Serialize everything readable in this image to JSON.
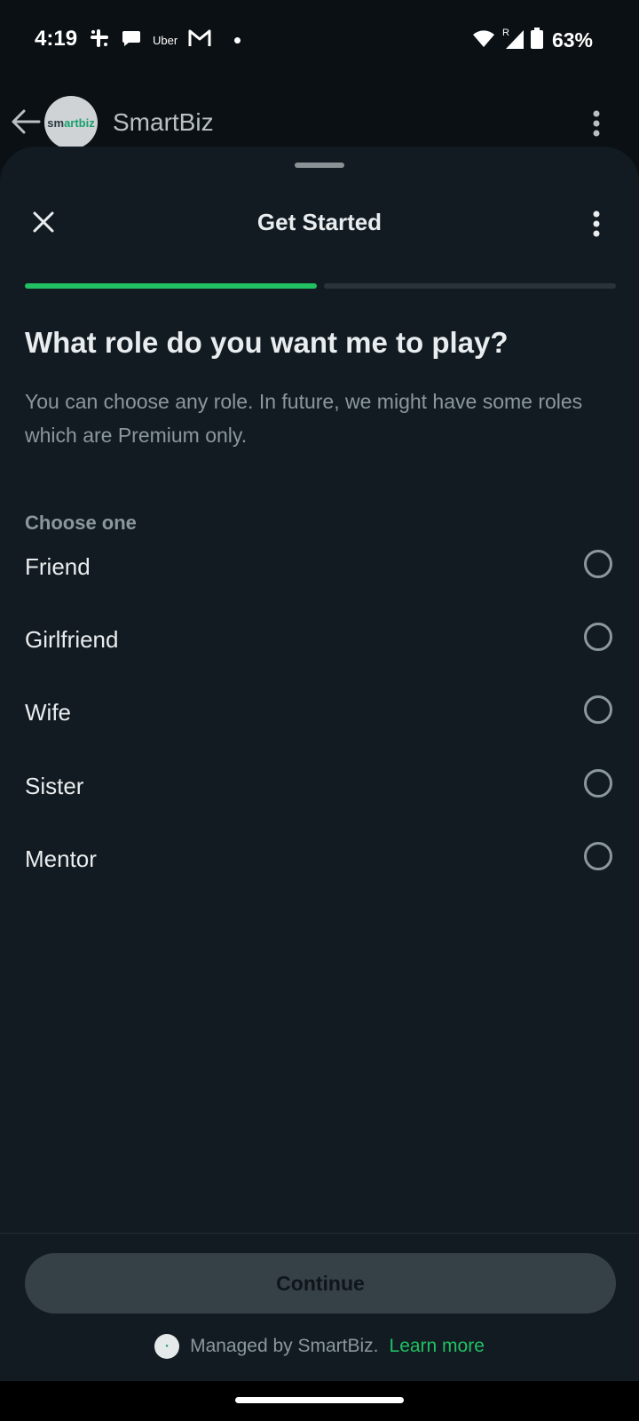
{
  "status_bar": {
    "time": "4:19",
    "uber_label": "Uber",
    "battery": "63%",
    "roaming": "R"
  },
  "chat_header": {
    "title": "SmartBiz",
    "avatar_text_a": "sm",
    "avatar_text_b": "artbiz"
  },
  "sheet": {
    "title": "Get Started",
    "progress_fraction": 0.5,
    "question": "What role do you want me to play?",
    "description": "You can choose any role. In future, we might have some roles which are Premium only.",
    "choose_label": "Choose one",
    "options": [
      {
        "label": "Friend",
        "selected": false
      },
      {
        "label": "Girlfriend",
        "selected": false
      },
      {
        "label": "Wife",
        "selected": false
      },
      {
        "label": "Sister",
        "selected": false
      },
      {
        "label": "Mentor",
        "selected": false
      }
    ],
    "continue_label": "Continue",
    "managed_text": "Managed by SmartBiz.",
    "learn_more": "Learn more"
  },
  "colors": {
    "accent": "#21c063",
    "sheet_bg": "#121b21",
    "text_primary": "#e9edef",
    "text_secondary": "#8b979e"
  }
}
